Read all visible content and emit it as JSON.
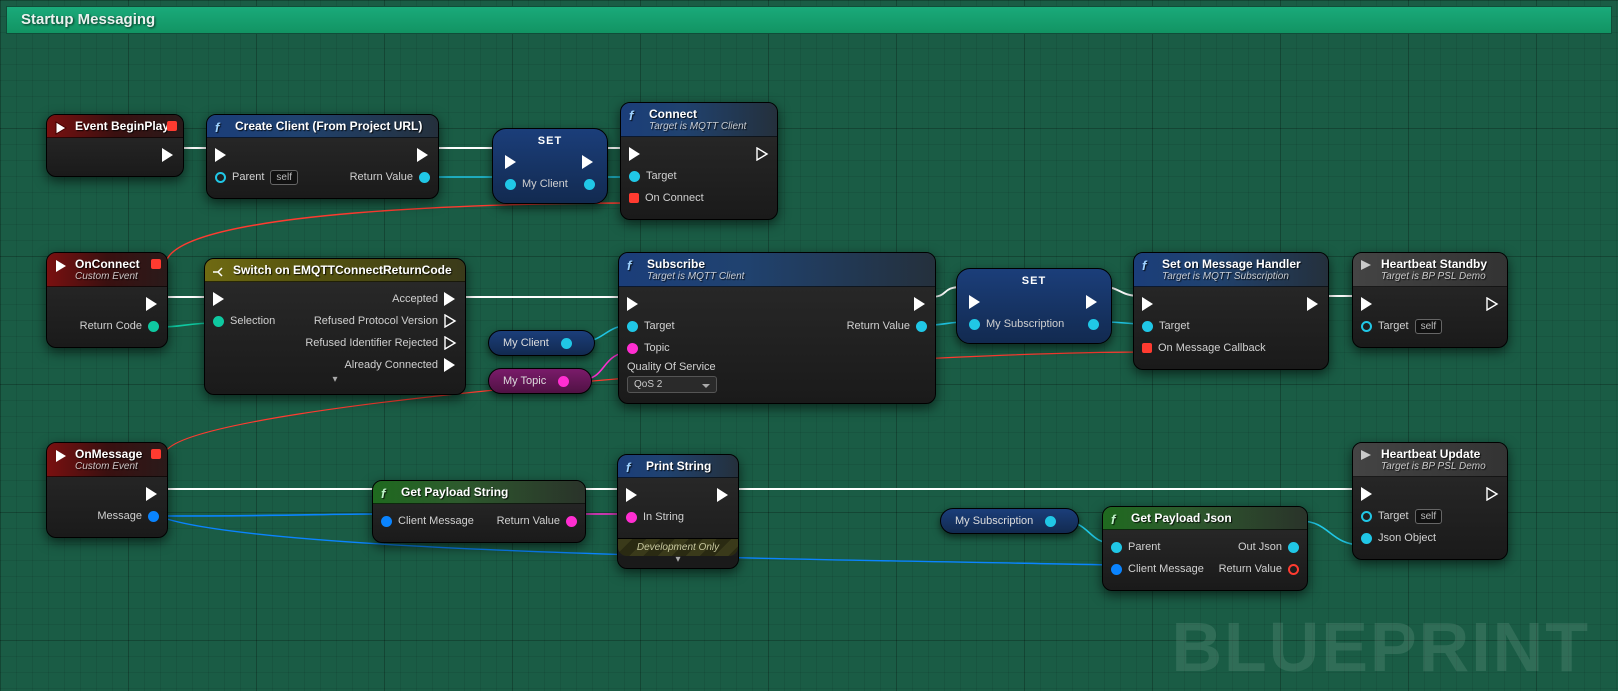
{
  "banner": {
    "title": "Startup Messaging"
  },
  "watermark": "BLUEPRINT",
  "pins": {
    "self_label": "self"
  },
  "nodes": {
    "beginplay": {
      "title": "Event BeginPlay"
    },
    "createclient": {
      "title": "Create Client (From Project URL)",
      "inputs": [
        "Parent"
      ],
      "outputs": [
        "Return Value"
      ]
    },
    "set1": {
      "title": "SET",
      "var": "My Client"
    },
    "connect": {
      "title": "Connect",
      "subtitle": "Target is MQTT Client",
      "inputs": [
        "Target",
        "On Connect"
      ]
    },
    "onconnect": {
      "title": "OnConnect",
      "subtitle": "Custom Event",
      "outputs": [
        "Return Code"
      ]
    },
    "switch": {
      "title": "Switch on EMQTTConnectReturnCode",
      "selection_label": "Selection",
      "cases": [
        "Accepted",
        "Refused Protocol Version",
        "Refused Identifier Rejected",
        "Already Connected"
      ]
    },
    "var_myclient": {
      "label": "My Client"
    },
    "var_mytopic": {
      "label": "My Topic"
    },
    "subscribe": {
      "title": "Subscribe",
      "subtitle": "Target is MQTT Client",
      "inputs": [
        "Target",
        "Topic",
        "Quality Of Service"
      ],
      "outputs": [
        "Return Value"
      ],
      "qos_value": "QoS 2"
    },
    "set2": {
      "title": "SET",
      "var": "My Subscription"
    },
    "setmsghandler": {
      "title": "Set on Message Handler",
      "subtitle": "Target is MQTT Subscription",
      "inputs": [
        "Target",
        "On Message Callback"
      ]
    },
    "heartbeat_standby": {
      "title": "Heartbeat Standby",
      "subtitle": "Target is BP PSL Demo",
      "inputs": [
        "Target"
      ]
    },
    "onmessage": {
      "title": "OnMessage",
      "subtitle": "Custom Event",
      "outputs": [
        "Message"
      ]
    },
    "getpayloadstr": {
      "title": "Get Payload String",
      "inputs": [
        "Client Message"
      ],
      "outputs": [
        "Return Value"
      ]
    },
    "printstring": {
      "title": "Print String",
      "inputs": [
        "In String"
      ],
      "footer": "Development Only"
    },
    "var_mysub": {
      "label": "My Subscription"
    },
    "getpayloadjson": {
      "title": "Get Payload Json",
      "inputs": [
        "Parent",
        "Client Message"
      ],
      "outputs": [
        "Out Json",
        "Return Value"
      ]
    },
    "heartbeat_update": {
      "title": "Heartbeat Update",
      "subtitle": "Target is BP PSL Demo",
      "inputs": [
        "Target",
        "Json Object"
      ]
    }
  }
}
